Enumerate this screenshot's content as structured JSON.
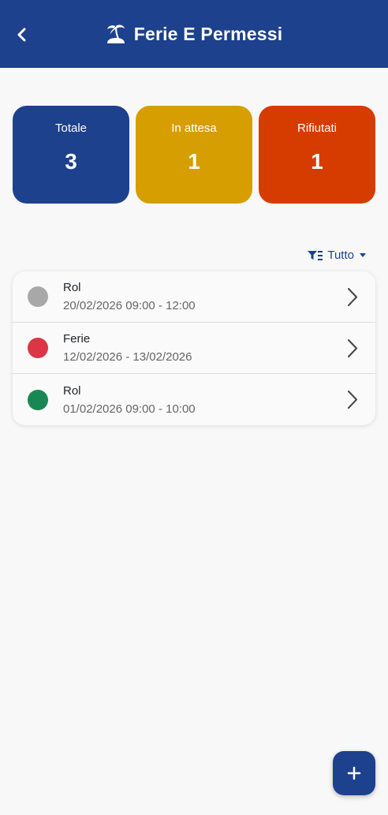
{
  "header": {
    "title": "Ferie E Permessi",
    "back_icon": "chevron-left-icon",
    "title_icon": "island-palm-icon",
    "background": "#1d418c"
  },
  "summary_cards": [
    {
      "label": "Totale",
      "value": "3",
      "color": "#1d418c"
    },
    {
      "label": "In attesa",
      "value": "1",
      "color": "#d69e00"
    },
    {
      "label": "Rifiutati",
      "value": "1",
      "color": "#d63c00"
    }
  ],
  "filter": {
    "icon": "filter-list-icon",
    "selected": "Tutto"
  },
  "requests": [
    {
      "type": "Rol",
      "period": "20/02/2026 09:00 - 12:00",
      "status_color": "#a8a8a8"
    },
    {
      "type": "Ferie",
      "period": "12/02/2026 - 13/02/2026",
      "status_color": "#dc3545"
    },
    {
      "type": "Rol",
      "period": "01/02/2026 09:00 - 10:00",
      "status_color": "#198754"
    }
  ],
  "fab": {
    "icon": "plus-icon"
  }
}
